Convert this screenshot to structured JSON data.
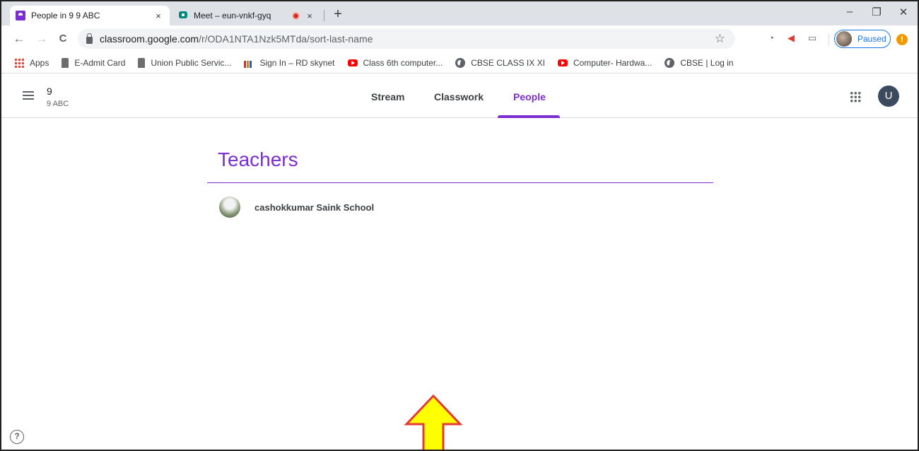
{
  "browser": {
    "tabs": [
      {
        "title": "People in 9 9 ABC",
        "close": "×"
      },
      {
        "title": "Meet – eun-vnkf-gyq",
        "close": "×"
      }
    ],
    "new_tab": "+",
    "window_controls": {
      "minimize": "–",
      "restore": "❐",
      "close": "✕"
    },
    "nav": {
      "back": "←",
      "forward": "→",
      "reload": "C"
    },
    "url": {
      "host": "classroom.google.com",
      "path": "/r/ODA1NTA1Nzk5MTda/sort-last-name"
    },
    "star": "☆",
    "profile": {
      "status": "Paused"
    },
    "warning": "!",
    "bookmarks": [
      {
        "label": "Apps",
        "icon": "apps-grid-icon"
      },
      {
        "label": "E-Admit Card",
        "icon": "emblem-icon"
      },
      {
        "label": "Union Public Servic...",
        "icon": "emblem-icon"
      },
      {
        "label": "Sign In – RD skynet",
        "icon": "bar-logo-icon"
      },
      {
        "label": "Class 6th computer...",
        "icon": "youtube-icon"
      },
      {
        "label": "CBSE CLASS IX XI",
        "icon": "globe-icon"
      },
      {
        "label": "Computer- Hardwa...",
        "icon": "youtube-icon"
      },
      {
        "label": "CBSE | Log in",
        "icon": "globe-icon"
      }
    ]
  },
  "classroom": {
    "class_name": "9",
    "class_section": "9 ABC",
    "tabs": [
      {
        "label": "Stream"
      },
      {
        "label": "Classwork"
      },
      {
        "label": "People"
      }
    ],
    "user_initial": "U"
  },
  "people": {
    "section_title": "Teachers",
    "teachers": [
      {
        "name": "cashokkumar Saink School"
      }
    ]
  },
  "help": "?",
  "colors": {
    "accent": "#7b2fd0",
    "arrow_fill": "#ffff00",
    "arrow_stroke": "#e53935"
  }
}
